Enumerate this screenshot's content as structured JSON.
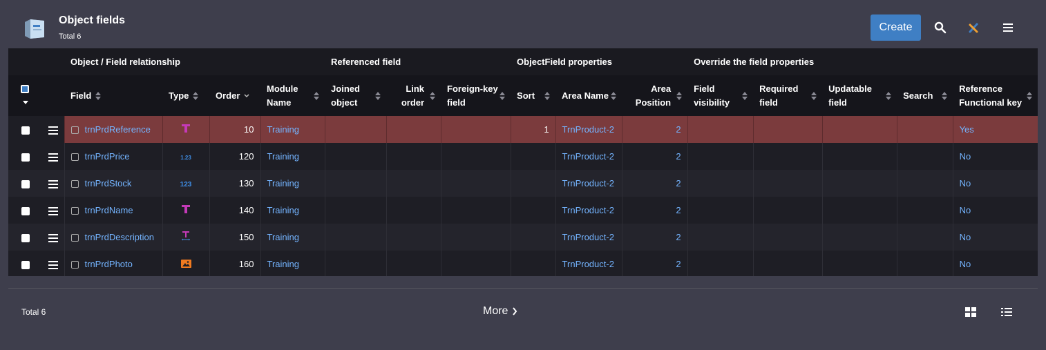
{
  "header": {
    "title": "Object fields",
    "subtitle": "Total 6",
    "create_label": "Create"
  },
  "table": {
    "groups": [
      "Object / Field relationship",
      "Referenced field",
      "ObjectField properties",
      "Override the field properties"
    ],
    "columns": {
      "field": "Field",
      "type": "Type",
      "order": "Order",
      "module_name": "Module Name",
      "joined_object": "Joined object",
      "link_order": "Link order",
      "foreign_key": "Foreign-key field",
      "sort": "Sort",
      "area_name": "Area Name",
      "area_position": "Area Position",
      "field_visibility": "Field visibility",
      "required_field": "Required field",
      "updatable_field": "Updatable field",
      "search": "Search",
      "ref_functional_key": "Reference Functional key"
    },
    "rows": [
      {
        "field": "trnPrdReference",
        "type_icon": "text-type-icon",
        "order": "10",
        "module": "Training",
        "sort": "1",
        "area_name": "TrnProduct-2",
        "area_position": "2",
        "ref_key": "Yes"
      },
      {
        "field": "trnPrdPrice",
        "type_icon": "decimal-type-icon",
        "order": "120",
        "module": "Training",
        "sort": "",
        "area_name": "TrnProduct-2",
        "area_position": "2",
        "ref_key": "No"
      },
      {
        "field": "trnPrdStock",
        "type_icon": "integer-type-icon",
        "order": "130",
        "module": "Training",
        "sort": "",
        "area_name": "TrnProduct-2",
        "area_position": "2",
        "ref_key": "No"
      },
      {
        "field": "trnPrdName",
        "type_icon": "text-type-icon",
        "order": "140",
        "module": "Training",
        "sort": "",
        "area_name": "TrnProduct-2",
        "area_position": "2",
        "ref_key": "No"
      },
      {
        "field": "trnPrdDescription",
        "type_icon": "long-text-type-icon",
        "order": "150",
        "module": "Training",
        "sort": "",
        "area_name": "TrnProduct-2",
        "area_position": "2",
        "ref_key": "No"
      },
      {
        "field": "trnPrdPhoto",
        "type_icon": "image-type-icon",
        "order": "160",
        "module": "Training",
        "sort": "",
        "area_name": "TrnProduct-2",
        "area_position": "2",
        "ref_key": "No"
      }
    ]
  },
  "type_icon_text": {
    "decimal": "1.23",
    "integer": "123"
  },
  "footer": {
    "total": "Total 6",
    "more_label": "More"
  },
  "colors": {
    "background": "#3e3e4c",
    "accent": "#3f7fc4",
    "selected_row": "#7b3b3d",
    "link": "#74b4ff"
  }
}
